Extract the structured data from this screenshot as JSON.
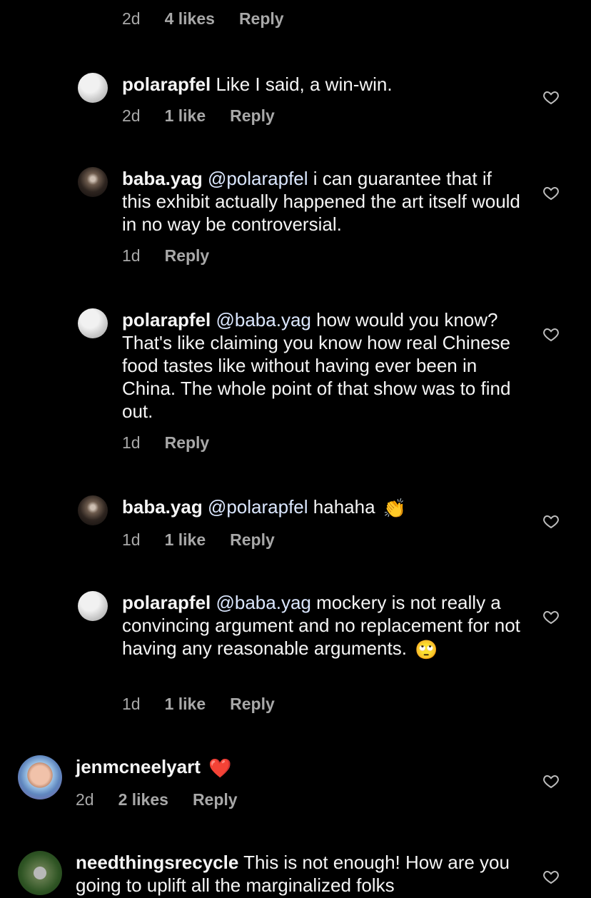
{
  "top_meta": {
    "time": "2d",
    "likes": "4 likes",
    "reply": "Reply"
  },
  "comments": [
    {
      "username": "polarapfel",
      "text": "Like I said, a win-win.",
      "time": "2d",
      "likes": "1 like",
      "reply": "Reply"
    },
    {
      "username": "baba.yag",
      "mention": "@polarapfel",
      "text": "i can guarantee that if this exhibit actually happened the art itself would in no way be controversial.",
      "time": "1d",
      "reply": "Reply"
    },
    {
      "username": "polarapfel",
      "mention": "@baba.yag",
      "text": "how would you know? That's like claiming you know how real Chinese food tastes like without having ever been in China. The whole point of that show was to find out.",
      "time": "1d",
      "reply": "Reply"
    },
    {
      "username": "baba.yag",
      "mention": "@polarapfel",
      "text": "hahaha",
      "emoji": "👏",
      "time": "1d",
      "likes": "1 like",
      "reply": "Reply"
    },
    {
      "username": "polarapfel",
      "mention": "@baba.yag",
      "text": "mockery is not really a convincing argument and no replacement for not having any reasonable arguments.",
      "emoji": "🙄",
      "time": "1d",
      "likes": "1 like",
      "reply": "Reply"
    },
    {
      "username": "jenmcneelyart",
      "emoji": "❤️",
      "time": "2d",
      "likes": "2 likes",
      "reply": "Reply"
    },
    {
      "username": "needthingsrecycle",
      "text": "This is not enough! How are you going to uplift all the marginalized folks"
    }
  ],
  "colors": {
    "background": "#000000",
    "text": "#f5f5f5",
    "meta": "#a8a8a8",
    "mention": "#dbe7ff",
    "heart_outline": "#bdbdbd"
  }
}
